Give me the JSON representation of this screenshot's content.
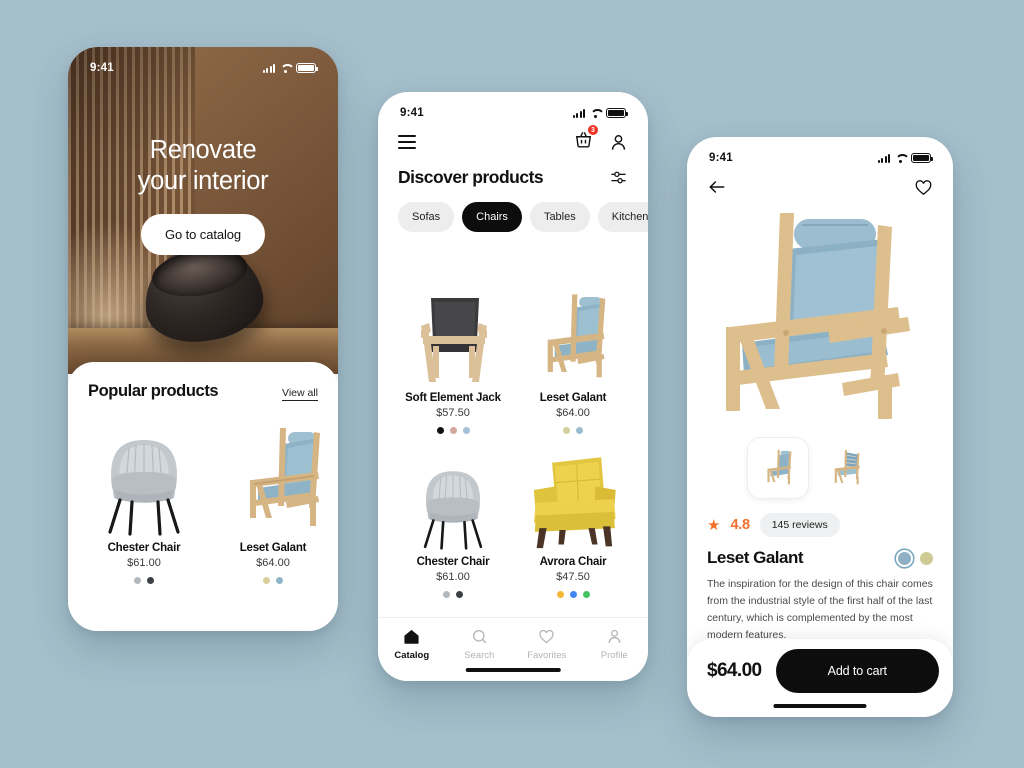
{
  "background_color": "#a5bfcb",
  "phone1": {
    "status": {
      "time": "9:41"
    },
    "hero": {
      "title_line1": "Renovate",
      "title_line2": "your interior",
      "cta_label": "Go to catalog"
    },
    "popular": {
      "heading": "Popular products",
      "view_all_label": "View all",
      "products": [
        {
          "name": "Chester Chair",
          "price": "$61.00",
          "colors": [
            "#b3b8bd",
            "#3c4044"
          ]
        },
        {
          "name": "Leset Galant",
          "price": "$64.00",
          "colors": [
            "#d9cf9a",
            "#8fb7c9"
          ]
        }
      ]
    }
  },
  "phone2": {
    "status": {
      "time": "9:41"
    },
    "header": {
      "menu_icon": "hamburger-icon",
      "cart_icon": "basket-icon",
      "cart_badge": "3",
      "profile_icon": "person-icon",
      "title": "Discover products",
      "filter_icon": "filter-sliders-icon"
    },
    "categories": [
      {
        "label": "Sofas",
        "active": false
      },
      {
        "label": "Chairs",
        "active": true
      },
      {
        "label": "Tables",
        "active": false
      },
      {
        "label": "Kitchen",
        "active": false
      }
    ],
    "products": [
      {
        "name": "Soft Element Jack",
        "price": "$57.50",
        "colors": [
          "#111111",
          "#d3a79b",
          "#a7c0d6"
        ]
      },
      {
        "name": "Leset Galant",
        "price": "$64.00",
        "colors": [
          "#d3cf9c",
          "#9cbcd1"
        ]
      },
      {
        "name": "Chester Chair",
        "price": "$61.00",
        "colors": [
          "#b3b8bd",
          "#3c4044"
        ]
      },
      {
        "name": "Avrora Chair",
        "price": "$47.50",
        "colors": [
          "#f2b733",
          "#4285f4",
          "#43c463"
        ]
      }
    ],
    "tabs": [
      {
        "label": "Catalog",
        "icon": "home-icon",
        "active": true
      },
      {
        "label": "Search",
        "icon": "search-icon",
        "active": false
      },
      {
        "label": "Favorites",
        "icon": "heart-icon",
        "active": false
      },
      {
        "label": "Profile",
        "icon": "person-icon",
        "active": false
      }
    ]
  },
  "phone3": {
    "status": {
      "time": "9:41"
    },
    "header": {
      "back_icon": "arrow-left-icon",
      "favorite_icon": "heart-icon"
    },
    "product": {
      "name": "Leset Galant",
      "rating": "4.8",
      "reviews_label": "145 reviews",
      "description": "The inspiration for the design of this chair comes from the industrial style of the first half of the last century, which is complemented by the most modern features.",
      "price": "$64.00",
      "add_to_cart_label": "Add to cart",
      "colors": [
        {
          "hex": "#8fb0c4",
          "selected": true
        },
        {
          "hex": "#cfcb95",
          "selected": false
        }
      ],
      "rating_color": "#f4702a"
    }
  }
}
